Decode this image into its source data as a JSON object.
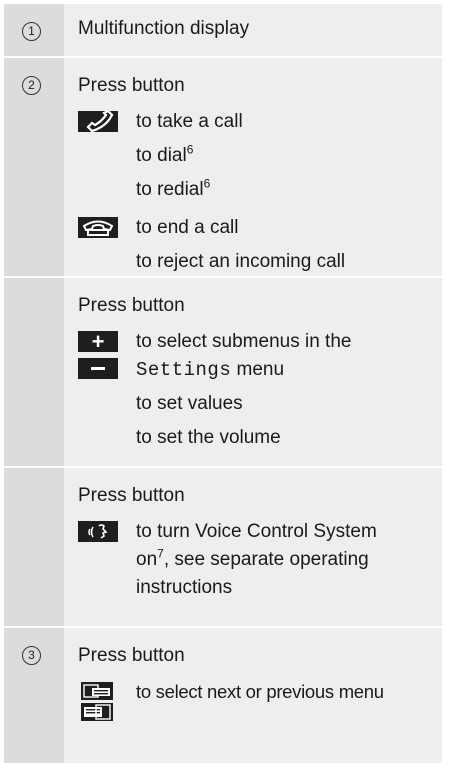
{
  "rows": [
    {
      "num": "1",
      "title": "Multifunction display"
    },
    {
      "num": "2",
      "press": "Press button",
      "accept_lines": [
        "to take a call",
        "to dial",
        "to redial"
      ],
      "dial_sup": "6",
      "redial_sup": "6",
      "end_lines": [
        "to end a call",
        "to reject an incoming call"
      ]
    },
    {
      "press": "Press button",
      "plus_line": "to select submenus in the",
      "minus_pre": "Settings",
      "minus_post": " menu",
      "extra_lines": [
        "to set values",
        "to set the volume"
      ]
    },
    {
      "press": "Press button",
      "voice_pre": "to turn Voice Control System",
      "voice_line2_pre": "on",
      "voice_sup": "7",
      "voice_line2_post": ", see separate operating",
      "voice_line3": "instructions"
    },
    {
      "num": "3",
      "press": "Press button",
      "menu_line": "to select next or previous menu"
    }
  ],
  "icons": [
    "phone-accept-icon",
    "phone-end-icon",
    "plus-icon",
    "minus-icon",
    "voice-control-icon",
    "menu-next-icon",
    "menu-previous-icon"
  ]
}
